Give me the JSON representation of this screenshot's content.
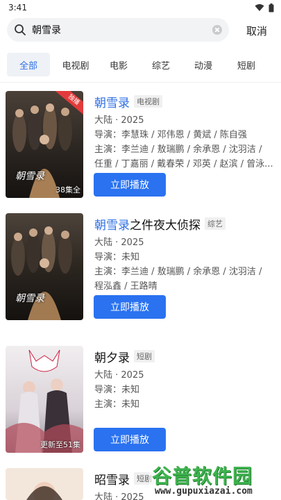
{
  "status": {
    "time": "3:41"
  },
  "search": {
    "query": "朝雪录",
    "cancel_label": "取消"
  },
  "tabs": [
    {
      "label": "全部",
      "active": true
    },
    {
      "label": "电视剧"
    },
    {
      "label": "电影"
    },
    {
      "label": "综艺"
    },
    {
      "label": "动漫"
    },
    {
      "label": "短剧"
    }
  ],
  "results": [
    {
      "title_highlight": "朝雪录",
      "title_rest": "",
      "type_badge": "电视剧",
      "corner_badge": "独播",
      "poster_note": "38集全",
      "poster_logo": "朝雪录",
      "meta": "大陆 · 2025",
      "director": "导演：李慧珠 / 邓伟恩 / 黄斌 / 陈自强",
      "cast_1": "主演：李兰迪 / 敖瑞鹏 / 余承恩 / 沈羽洁 /",
      "cast_2": "任重 / 丁嘉丽 / 戴春荣 / 邓英 / 赵滨 / 曾泳...",
      "play_label": "立即播放"
    },
    {
      "title_highlight": "朝雪录",
      "title_rest": "之件夜大侦探",
      "type_badge": "综艺",
      "poster_logo": "朝雪录",
      "meta": "大陆 · 2025",
      "director": "导演：未知",
      "cast_1": "主演：李兰迪 / 敖瑞鹏 / 余承恩 / 沈羽洁 /",
      "cast_2": "程泓鑫 / 王路晴",
      "play_label": "立即播放"
    },
    {
      "title_highlight": "",
      "title_rest": "朝夕录",
      "type_badge": "短剧",
      "poster_note": "更新至51集",
      "meta": "大陆 · 2025",
      "director": "导演：未知",
      "cast_1": "主演：未知",
      "cast_2": "",
      "play_label": "立即播放"
    },
    {
      "title_highlight": "",
      "title_rest": "昭雪录",
      "type_badge": "短剧",
      "meta": "大陆 · 2025"
    }
  ],
  "watermark": {
    "main": "谷普软件园",
    "sub": "www.gupuxiazai.com"
  },
  "colors": {
    "accent": "#2a72f0",
    "highlight": "#2f6fe4",
    "corner_badge": "#e23b3b",
    "watermark": "#3fb34f"
  }
}
